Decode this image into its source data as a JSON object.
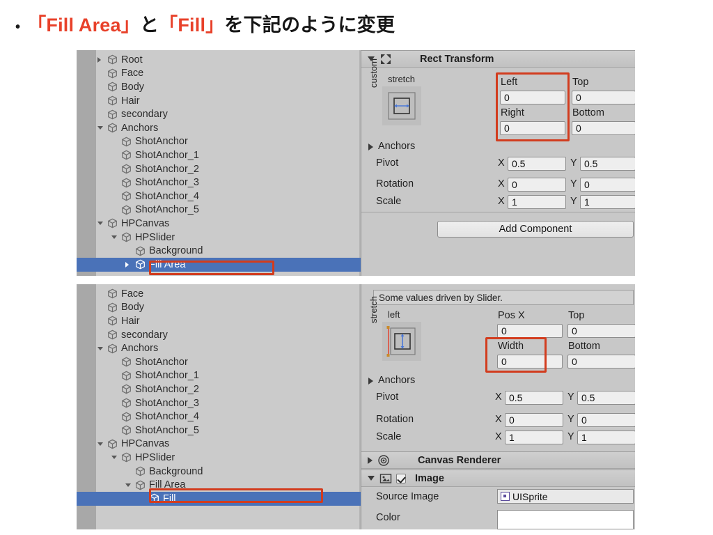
{
  "slide": {
    "bullet": "•",
    "title_part1": "「Fill Area」",
    "title_part2": " と ",
    "title_part3": "「Fill」",
    "title_part4": " を下記のように変更",
    "accent_color": "#e8412a",
    "text_color": "#161616"
  },
  "top_panel": {
    "hierarchy": {
      "items": [
        {
          "label": "Root",
          "indent": 0,
          "arrow": "closed"
        },
        {
          "label": "Face",
          "indent": 0,
          "arrow": "none"
        },
        {
          "label": "Body",
          "indent": 0,
          "arrow": "none"
        },
        {
          "label": "Hair",
          "indent": 0,
          "arrow": "none"
        },
        {
          "label": "secondary",
          "indent": 0,
          "arrow": "none"
        },
        {
          "label": "Anchors",
          "indent": 0,
          "arrow": "open"
        },
        {
          "label": "ShotAnchor",
          "indent": 1,
          "arrow": "none"
        },
        {
          "label": "ShotAnchor_1",
          "indent": 1,
          "arrow": "none"
        },
        {
          "label": "ShotAnchor_2",
          "indent": 1,
          "arrow": "none"
        },
        {
          "label": "ShotAnchor_3",
          "indent": 1,
          "arrow": "none"
        },
        {
          "label": "ShotAnchor_4",
          "indent": 1,
          "arrow": "none"
        },
        {
          "label": "ShotAnchor_5",
          "indent": 1,
          "arrow": "none"
        },
        {
          "label": "HPCanvas",
          "indent": 0,
          "arrow": "open"
        },
        {
          "label": "HPSlider",
          "indent": 1,
          "arrow": "open"
        },
        {
          "label": "Background",
          "indent": 2,
          "arrow": "none"
        },
        {
          "label": "Fill Area",
          "indent": 2,
          "arrow": "closed",
          "selected": true
        }
      ]
    },
    "inspector": {
      "component_title": "Rect Transform",
      "anchor_widget": {
        "top_label": "stretch",
        "left_label": "custom"
      },
      "fields": [
        {
          "label": "Left",
          "value": "0"
        },
        {
          "label": "Top",
          "value": "0"
        },
        {
          "label": "Right",
          "value": "0"
        },
        {
          "label": "Bottom",
          "value": "0"
        }
      ],
      "anchors_label": "Anchors",
      "rows": [
        {
          "label": "Pivot",
          "x_axis": "X",
          "x": "0.5",
          "y_axis": "Y",
          "y": "0.5"
        },
        {
          "label": "Rotation",
          "x_axis": "X",
          "x": "0",
          "y_axis": "Y",
          "y": "0"
        },
        {
          "label": "Scale",
          "x_axis": "X",
          "x": "1",
          "y_axis": "Y",
          "y": "1"
        }
      ],
      "add_component": "Add Component"
    }
  },
  "bottom_panel": {
    "hierarchy": {
      "items": [
        {
          "label": "Face",
          "indent": 0,
          "arrow": "none"
        },
        {
          "label": "Body",
          "indent": 0,
          "arrow": "none"
        },
        {
          "label": "Hair",
          "indent": 0,
          "arrow": "none"
        },
        {
          "label": "secondary",
          "indent": 0,
          "arrow": "none"
        },
        {
          "label": "Anchors",
          "indent": 0,
          "arrow": "open"
        },
        {
          "label": "ShotAnchor",
          "indent": 1,
          "arrow": "none"
        },
        {
          "label": "ShotAnchor_1",
          "indent": 1,
          "arrow": "none"
        },
        {
          "label": "ShotAnchor_2",
          "indent": 1,
          "arrow": "none"
        },
        {
          "label": "ShotAnchor_3",
          "indent": 1,
          "arrow": "none"
        },
        {
          "label": "ShotAnchor_4",
          "indent": 1,
          "arrow": "none"
        },
        {
          "label": "ShotAnchor_5",
          "indent": 1,
          "arrow": "none"
        },
        {
          "label": "HPCanvas",
          "indent": 0,
          "arrow": "open"
        },
        {
          "label": "HPSlider",
          "indent": 1,
          "arrow": "open"
        },
        {
          "label": "Background",
          "indent": 2,
          "arrow": "none"
        },
        {
          "label": "Fill Area",
          "indent": 2,
          "arrow": "open"
        },
        {
          "label": "Fill",
          "indent": 3,
          "arrow": "none",
          "selected": true
        }
      ]
    },
    "inspector": {
      "info_message": "Some values driven by Slider.",
      "anchor_widget": {
        "top_label": "left",
        "left_label": "stretch"
      },
      "fields": [
        {
          "label": "Pos X",
          "value": "0"
        },
        {
          "label": "Top",
          "value": "0"
        },
        {
          "label": "Width",
          "value": "0"
        },
        {
          "label": "Bottom",
          "value": "0"
        }
      ],
      "anchors_label": "Anchors",
      "rows": [
        {
          "label": "Pivot",
          "x_axis": "X",
          "x": "0.5",
          "y_axis": "Y",
          "y": "0.5"
        },
        {
          "label": "Rotation",
          "x_axis": "X",
          "x": "0",
          "y_axis": "Y",
          "y": "0"
        },
        {
          "label": "Scale",
          "x_axis": "X",
          "x": "1",
          "y_axis": "Y",
          "y": "1"
        }
      ],
      "canvas_renderer_title": "Canvas Renderer",
      "image_title": "Image",
      "source_image_label": "Source Image",
      "source_image_value": "UISprite",
      "color_label": "Color",
      "color_value": "#ffffff"
    }
  },
  "annotations": {
    "highlight_color": "#d23c1e",
    "selection_color": "#4a72b8"
  }
}
